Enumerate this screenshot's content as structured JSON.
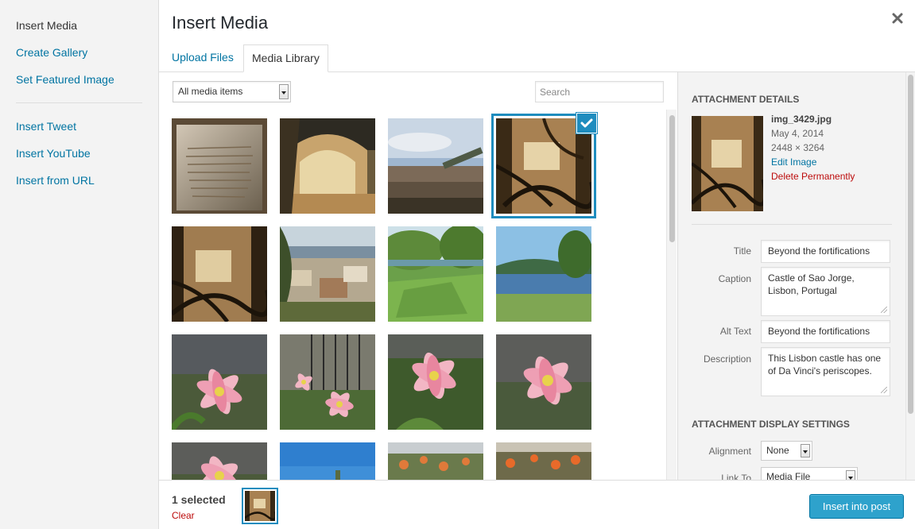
{
  "menu": {
    "items": [
      {
        "label": "Insert Media",
        "active": true
      },
      {
        "label": "Create Gallery"
      },
      {
        "label": "Set Featured Image"
      },
      {
        "label": "Insert Tweet"
      },
      {
        "label": "Insert YouTube"
      },
      {
        "label": "Insert from URL"
      }
    ]
  },
  "modal": {
    "title": "Insert Media",
    "close_icon": "close-icon"
  },
  "tabs": [
    {
      "label": "Upload Files",
      "active": false
    },
    {
      "label": "Media Library",
      "active": true
    }
  ],
  "browser": {
    "filter_value": "All media items",
    "search_placeholder": "Search",
    "selected_index": 3,
    "thumbnails": [
      "stone-inscription",
      "stone-archway",
      "city-view-cannon",
      "tree-roots-wall",
      "tree-roots-wall-2",
      "hillside-town",
      "park-lawn",
      "lake-shore",
      "pink-lily",
      "pink-lily-fence",
      "pink-lily-2",
      "pink-lily-3",
      "pink-lily-4",
      "blue-sky",
      "orange-flowers",
      "orange-flowers-2"
    ]
  },
  "attachment": {
    "heading": "Attachment Details",
    "filename": "img_3429.jpg",
    "date": "May 4, 2014",
    "dimensions": "2448 × 3264",
    "edit_link": "Edit Image",
    "delete_link": "Delete Permanently",
    "fields": {
      "title_label": "Title",
      "title_value": "Beyond the fortifications",
      "caption_label": "Caption",
      "caption_value": "Castle of Sao Jorge, Lisbon, Portugal",
      "alt_label": "Alt Text",
      "alt_value": "Beyond the fortifications",
      "description_label": "Description",
      "description_value": "This Lisbon castle has one of Da Vinci's periscopes."
    }
  },
  "display_settings": {
    "heading": "Attachment Display Settings",
    "alignment_label": "Alignment",
    "alignment_value": "None",
    "link_label": "Link To",
    "link_value": "Media File"
  },
  "toolbar": {
    "selected_count": "1 selected",
    "clear_label": "Clear",
    "insert_button": "Insert into post"
  },
  "colors": {
    "accent": "#1e8cbe",
    "link": "#0074a2",
    "danger": "#bc0b0b",
    "primary_button": "#2ea2cc"
  }
}
